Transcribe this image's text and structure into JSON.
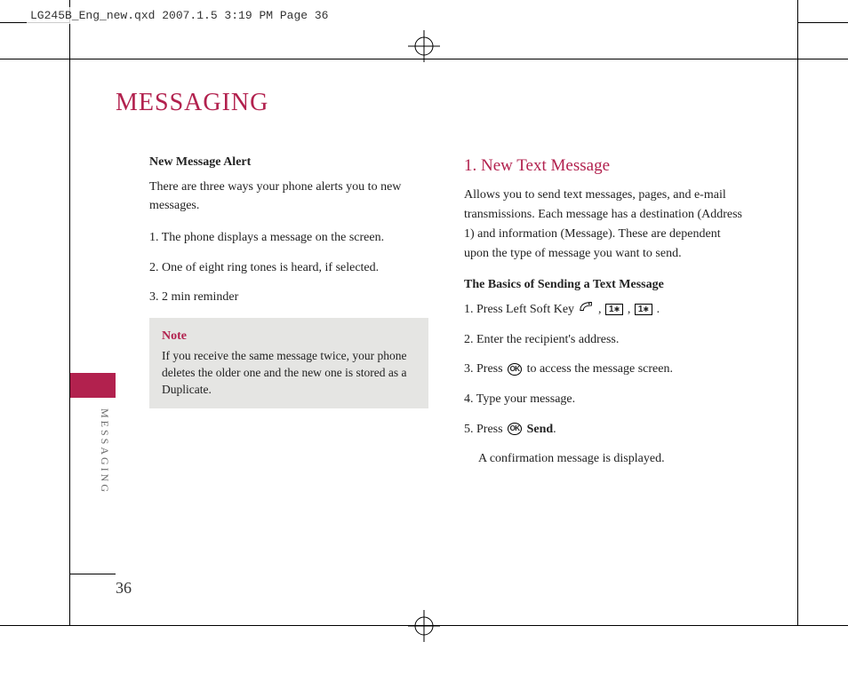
{
  "meta": {
    "header_line": "LG245B_Eng_new.qxd  2007.1.5  3:19 PM  Page 36"
  },
  "title": "MESSAGING",
  "side_label": "MESSAGING",
  "page_number": "36",
  "left_col": {
    "subhead": "New Message Alert",
    "intro": "There are three ways your phone alerts you to new messages.",
    "items": [
      "1. The phone displays a message on the screen.",
      "2. One of eight ring tones is heard, if selected.",
      "3. 2 min reminder"
    ],
    "note_title": "Note",
    "note_body": "If you receive the same message twice, your phone deletes the older one and the new one is stored as a Duplicate."
  },
  "right_col": {
    "section_head": "1. New Text Message",
    "intro": "Allows you to send text messages, pages, and e-mail transmissions. Each message has a destination (Address 1) and information (Message). These are dependent upon the type of message you want to send.",
    "basics_head": "The Basics of Sending a Text Message",
    "step1_a": "1. Press Left Soft Key ",
    "step1_b": " , ",
    "step1_c": " , ",
    "step1_d": " .",
    "step2": "2. Enter the recipient's address.",
    "step3_a": "3. Press ",
    "step3_b": " to access the message screen.",
    "step4": "4. Type your message.",
    "step5_a": "5. Press ",
    "step5_b_bold": "Send",
    "step5_c": ".",
    "confirm": "A confirmation message is displayed."
  },
  "icons": {
    "ok_label": "OK"
  }
}
